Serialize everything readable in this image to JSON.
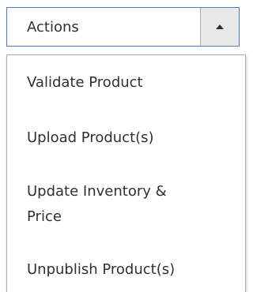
{
  "actions": {
    "label": "Actions",
    "toggle_icon": "caret-up-icon"
  },
  "menu": {
    "items": [
      {
        "label": "Validate Product"
      },
      {
        "label": "Upload Product(s)"
      },
      {
        "label": "Update Inventory & Price"
      },
      {
        "label": "Unpublish Product(s)"
      }
    ]
  },
  "colors": {
    "border_active": "#4a7fc0",
    "toggle_bg": "#e8e8e8",
    "text": "#303030"
  }
}
